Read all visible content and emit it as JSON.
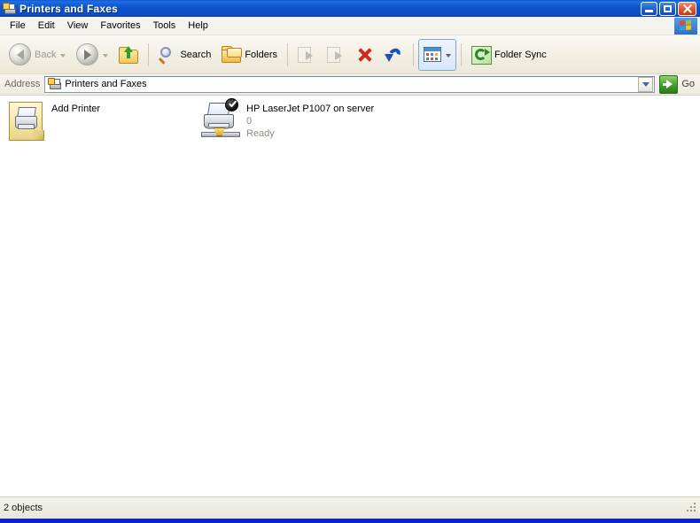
{
  "window": {
    "title": "Printers and Faxes",
    "title_icon": "printer-icon",
    "buttons": {
      "minimize": "Minimize",
      "maximize": "Maximize",
      "close": "Close"
    }
  },
  "menubar": {
    "items": [
      {
        "label": "File"
      },
      {
        "label": "Edit"
      },
      {
        "label": "View"
      },
      {
        "label": "Favorites"
      },
      {
        "label": "Tools"
      },
      {
        "label": "Help"
      }
    ],
    "logo": "windows-flag-icon"
  },
  "toolbar": {
    "back_label": "Back",
    "back_icon": "back-arrow-icon",
    "forward_icon": "forward-arrow-icon",
    "up_icon": "up-folder-icon",
    "search_label": "Search",
    "search_icon": "search-icon",
    "folders_label": "Folders",
    "folders_icon": "folders-icon",
    "move_to_icon": "move-to-folder-icon",
    "copy_to_icon": "copy-to-folder-icon",
    "delete_icon": "delete-x-icon",
    "undo_icon": "undo-arrow-icon",
    "views_icon": "views-icon",
    "folder_sync_label": "Folder Sync",
    "folder_sync_icon": "folder-sync-icon"
  },
  "address": {
    "label": "Address",
    "icon": "printer-folder-icon",
    "value": "Printers and Faxes",
    "dropdown_icon": "chevron-down-icon",
    "go_label": "Go",
    "go_icon": "go-arrow-icon"
  },
  "content": {
    "items": [
      {
        "name": "Add Printer",
        "icon": "add-printer-icon",
        "sub1": "",
        "sub2": ""
      },
      {
        "name": "HP LaserJet P1007 on server",
        "icon": "network-printer-icon",
        "badge": "default-printer-check-icon",
        "sub1": "0",
        "sub2": "Ready"
      }
    ]
  },
  "statusbar": {
    "text": "2 objects",
    "grip": "resize-grip-icon"
  },
  "colors": {
    "title_blue": "#0b4ec4",
    "toolbar_bg": "#f2efe4",
    "content_bg": "#ffffff",
    "status_bg": "#ece9dd",
    "accent_green": "#3f9e2c",
    "delete_red": "#d2291d",
    "undo_blue": "#1b4fbe",
    "bottom_bar": "#0a24c8"
  }
}
